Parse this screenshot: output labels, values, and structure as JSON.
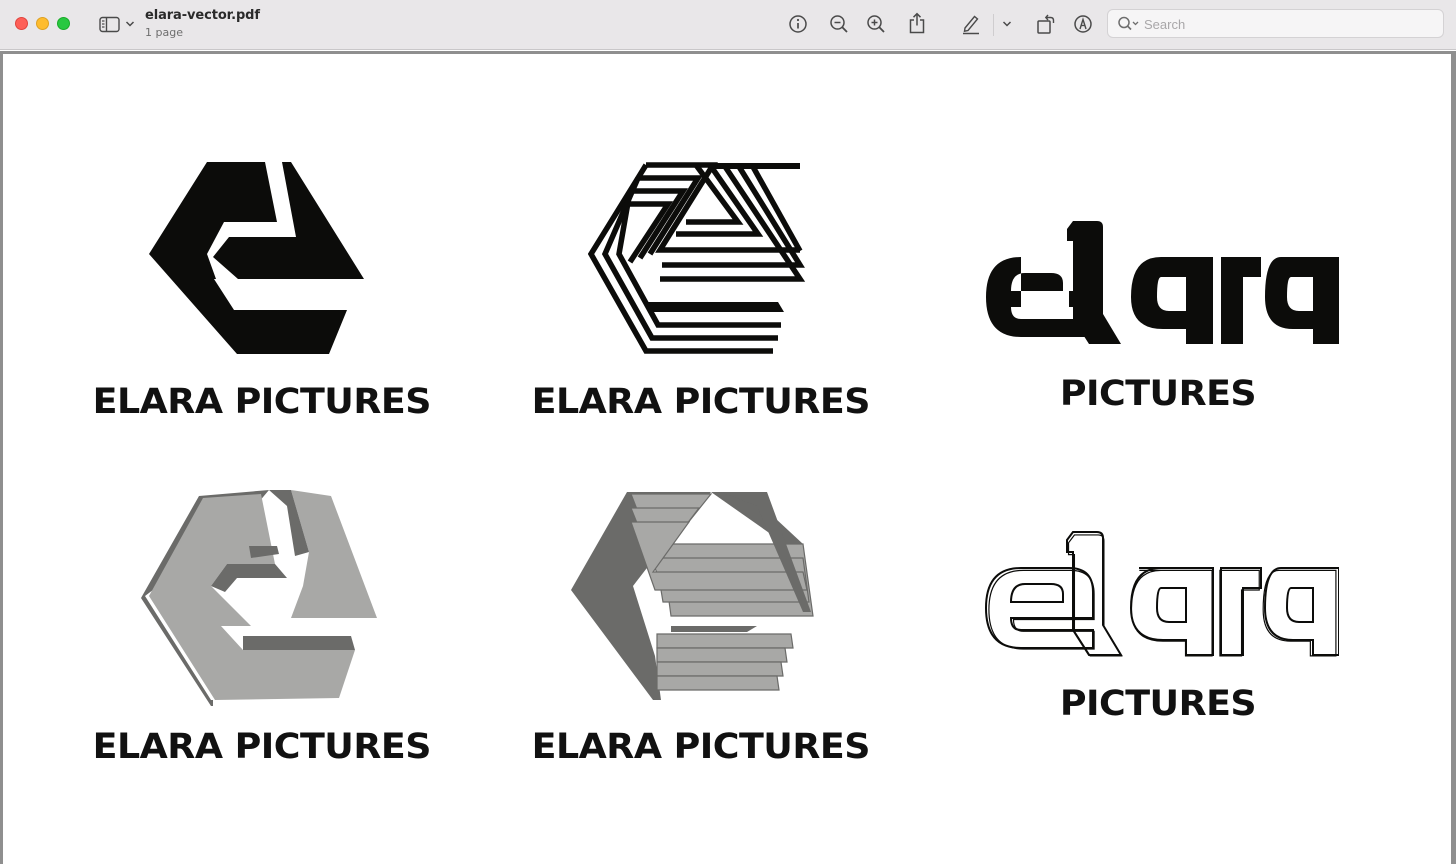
{
  "window": {
    "title": "elara-vector.pdf",
    "subtitle": "1 page"
  },
  "toolbar": {
    "icons": [
      "sidebar-icon",
      "chevron-down-icon",
      "info-icon",
      "zoom-out-icon",
      "zoom-in-icon",
      "share-icon",
      "highlight-pen-icon",
      "chevron-down-icon",
      "rotate-icon",
      "markup-icon",
      "search-icon"
    ]
  },
  "search": {
    "placeholder": "Search"
  },
  "document": {
    "logos": [
      {
        "caption": "ELARA PICTURES",
        "style": "solid-black"
      },
      {
        "caption": "ELARA PICTURES",
        "style": "striped-black"
      },
      {
        "word": "elara",
        "caption": "PICTURES",
        "style": "wordmark-solid"
      },
      {
        "caption": "ELARA PICTURES",
        "style": "3d-gray"
      },
      {
        "caption": "ELARA PICTURES",
        "style": "3d-striped-gray"
      },
      {
        "word": "elara",
        "caption": "PICTURES",
        "style": "wordmark-outline"
      }
    ]
  },
  "colors": {
    "logo_black": "#0c0c0a",
    "logo_gray_face": "#a8a8a6",
    "logo_gray_side": "#6b6b69",
    "titlebar_bg": "#e9e7e9"
  }
}
